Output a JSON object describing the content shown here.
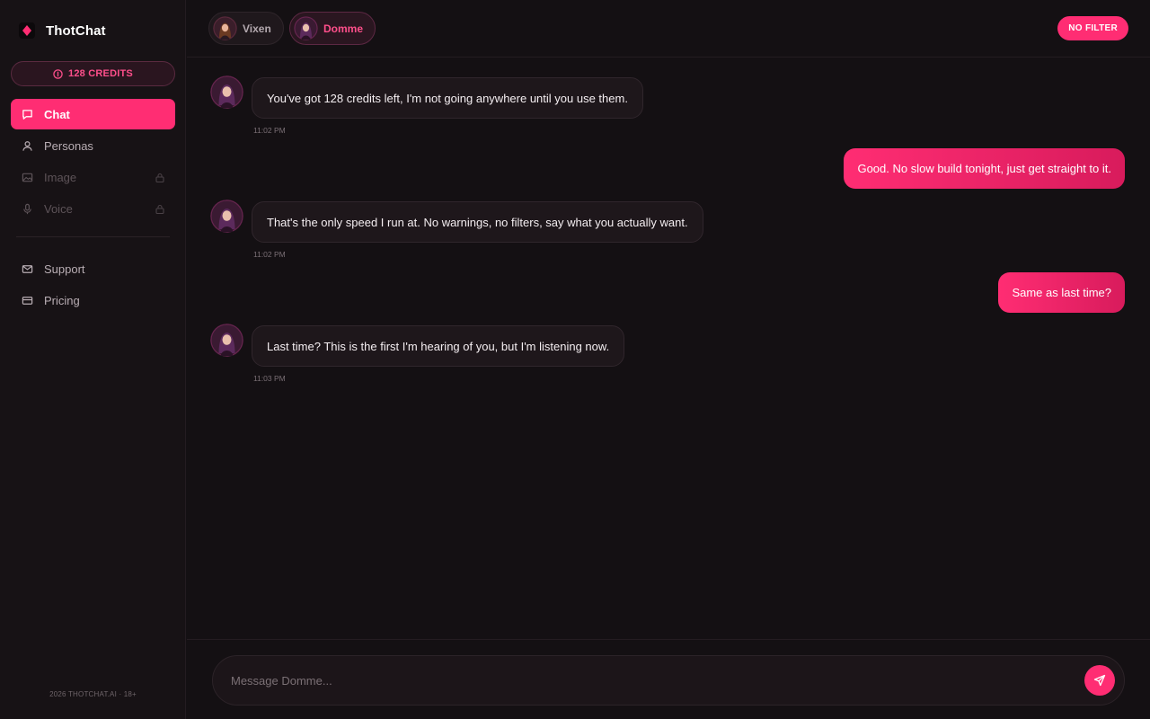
{
  "app": {
    "name": "ThotChat",
    "credits_label": "128 CREDITS",
    "footer": "2026 THOTCHAT.AI · 18+"
  },
  "sidebar": {
    "items": [
      {
        "label": "Chat",
        "icon": "chat-icon",
        "active": true,
        "locked": false
      },
      {
        "label": "Personas",
        "icon": "user-icon",
        "active": false,
        "locked": false
      },
      {
        "label": "Image",
        "icon": "image-icon",
        "active": false,
        "locked": true
      },
      {
        "label": "Voice",
        "icon": "microphone-icon",
        "active": false,
        "locked": true
      },
      {
        "label": "Support",
        "icon": "mail-icon",
        "active": false,
        "locked": false
      },
      {
        "label": "Pricing",
        "icon": "credit-card-icon",
        "active": false,
        "locked": false
      }
    ]
  },
  "header": {
    "personas": [
      {
        "name": "Vixen",
        "active": false
      },
      {
        "name": "Domme",
        "active": true
      }
    ],
    "no_filter_label": "NO FILTER"
  },
  "messages": [
    {
      "role": "bot",
      "text": "You've got 128 credits left, I'm not going anywhere until you use them.",
      "time": "11:02 PM"
    },
    {
      "role": "user",
      "text": "Good. No slow build tonight, just get straight to it."
    },
    {
      "role": "bot",
      "text": "That's the only speed I run at. No warnings, no filters, say what you actually want.",
      "time": "11:02 PM"
    },
    {
      "role": "user",
      "text": "Same as last time?"
    },
    {
      "role": "bot",
      "text": "Last time? This is the first I'm hearing of you, but I'm listening now.",
      "time": "11:03 PM"
    }
  ],
  "composer": {
    "placeholder": "Message Domme...",
    "value": ""
  },
  "colors": {
    "accent": "#ff2d73",
    "background": "#141013",
    "sidebar": "#171215"
  }
}
